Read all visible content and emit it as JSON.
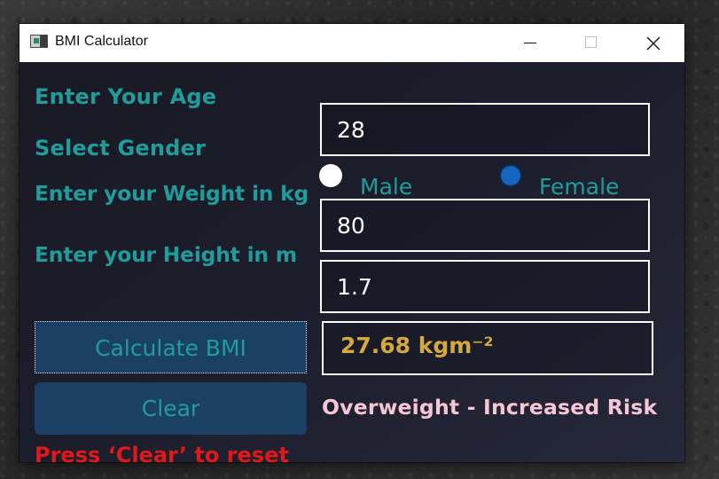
{
  "window": {
    "title": "BMI Calculator",
    "icon": "app-window-icon",
    "controls": {
      "minimize_icon": "minimize-icon",
      "maximize_icon": "maximize-icon",
      "close_icon": "close-icon"
    }
  },
  "form": {
    "age_label": "Enter Your Age",
    "age_value": "28",
    "gender_label": "Select Gender",
    "gender_options": [
      {
        "label": "Male",
        "selected": false
      },
      {
        "label": "Female",
        "selected": true
      }
    ],
    "weight_label": "Enter your Weight in kg",
    "weight_value": "80",
    "height_label": "Enter your Height in m",
    "height_value": "1.7"
  },
  "actions": {
    "calculate_label": "Calculate BMI",
    "clear_label": "Clear"
  },
  "result": {
    "bmi_text": "27.68 kgm⁻²",
    "category_text": "Overweight - Increased Risk",
    "hint_text": "Press ‘Clear’ to reset"
  },
  "colors": {
    "label_teal": "#1f9c9c",
    "button_bg": "#1c3f66",
    "result_gold": "#d4a83c",
    "category_pink": "#f7c6d4",
    "hint_red": "#e01818",
    "radio_selected": "#1565c0"
  }
}
